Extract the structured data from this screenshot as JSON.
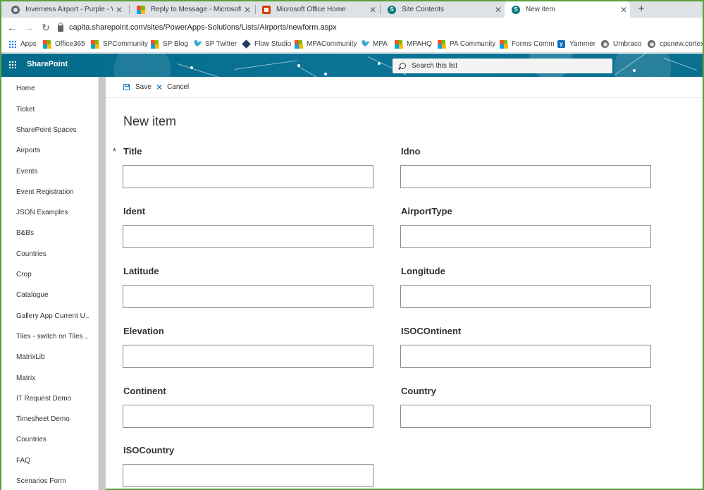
{
  "browser": {
    "tabs": [
      {
        "title": "Inverness Airport - Purple - WiFi",
        "icon": "globe-icon"
      },
      {
        "title": "Reply to Message - Microsoft Tech",
        "icon": "microsoft-icon"
      },
      {
        "title": "Microsoft Office Home",
        "icon": "office-icon"
      },
      {
        "title": "Site Contents",
        "icon": "sharepoint-icon"
      },
      {
        "title": "New item",
        "icon": "sharepoint-icon",
        "active": true
      }
    ],
    "close_glyph": "✕",
    "new_tab_glyph": "+",
    "url": "capita.sharepoint.com/sites/PowerApps-Solutions/Lists/Airports/newform.aspx",
    "back_glyph": "←",
    "forward_glyph": "→",
    "reload_glyph": "↻"
  },
  "bookmarks": [
    {
      "label": "Apps",
      "icon": "apps-grid-icon"
    },
    {
      "label": "Office365",
      "icon": "microsoft-icon"
    },
    {
      "label": "SPCommunity",
      "icon": "microsoft-icon"
    },
    {
      "label": "SP Blog",
      "icon": "microsoft-icon"
    },
    {
      "label": "SP Twitter",
      "icon": "twitter-icon"
    },
    {
      "label": "Flow Studio",
      "icon": "flow-icon"
    },
    {
      "label": "MPACommunity",
      "icon": "microsoft-icon"
    },
    {
      "label": "MPA",
      "icon": "twitter-icon"
    },
    {
      "label": "MPAHQ",
      "icon": "microsoft-icon"
    },
    {
      "label": "PA Community",
      "icon": "microsoft-icon"
    },
    {
      "label": "Forms Comm",
      "icon": "microsoft-icon"
    },
    {
      "label": "Yammer",
      "icon": "yammer-icon"
    },
    {
      "label": "Umbraco",
      "icon": "globe-icon"
    },
    {
      "label": "cpsnew.cortex.m",
      "icon": "globe-icon"
    }
  ],
  "suitebar": {
    "app_name": "SharePoint",
    "search_placeholder": "Search this list"
  },
  "leftnav": {
    "items": [
      "Home",
      "Ticket",
      "SharePoint Spaces",
      "Airports",
      "Events",
      "Event Registration",
      "JSON Examples",
      "B&Bs",
      "Countries",
      "Crop",
      "Catalogue",
      "Gallery App Current U...",
      "Tiles - switch on Tiles ...",
      "MatrixLib",
      "Matrix",
      "IT Request Demo",
      "Timesheet Demo",
      "Countries",
      "FAQ",
      "Scenarios Form"
    ]
  },
  "commandbar": {
    "save_label": "Save",
    "cancel_label": "Cancel"
  },
  "form": {
    "title": "New item",
    "required_marker": "*",
    "fields": [
      {
        "label": "Title",
        "value": "",
        "required": true
      },
      {
        "label": "Idno",
        "value": ""
      },
      {
        "label": "Ident",
        "value": ""
      },
      {
        "label": "AirportType",
        "value": ""
      },
      {
        "label": "Latitude",
        "value": ""
      },
      {
        "label": "Longitude",
        "value": ""
      },
      {
        "label": "Elevation",
        "value": ""
      },
      {
        "label": "ISOCOntinent",
        "value": ""
      },
      {
        "label": "Continent",
        "value": ""
      },
      {
        "label": "Country",
        "value": ""
      },
      {
        "label": "ISOCountry",
        "value": ""
      }
    ]
  },
  "colors": {
    "window_border": "#5aa03a",
    "suitebar": "#0a6e8a",
    "accent": "#0078d4"
  }
}
